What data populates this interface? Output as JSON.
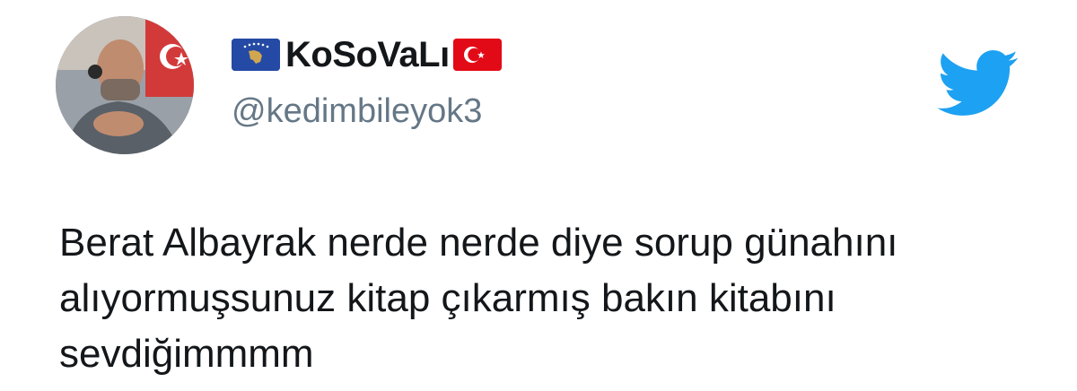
{
  "tweet": {
    "author": {
      "display_name": "KoSoVaLı",
      "handle": "@kedimbileyok3",
      "name_prefix_emoji": "kosovo-flag-icon",
      "name_suffix_emoji": "turkey-flag-icon"
    },
    "text_lines": [
      "Berat Albayrak nerde nerde diye sorup günahını",
      "alıyormuşsunuz kitap çıkarmış bakın kitabını",
      "sevdiğimmmm"
    ],
    "logo": "twitter-bird-icon"
  },
  "colors": {
    "twitter_blue": "#1da1f2",
    "handle_gray": "#657786",
    "text": "#14171a",
    "kosovo_blue": "#244aa5",
    "kosovo_gold": "#d0a650",
    "turkey_red": "#e30a17"
  }
}
